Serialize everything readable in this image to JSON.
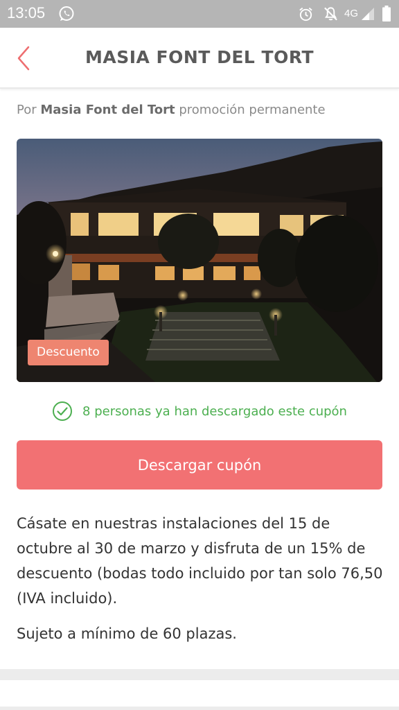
{
  "status_bar": {
    "time": "13:05",
    "network": "4G",
    "icons": [
      "whatsapp-icon",
      "alarm-icon",
      "notifications-off-icon",
      "signal-icon",
      "battery-icon"
    ]
  },
  "header": {
    "back_icon": "chevron-left-icon",
    "title": "MASIA FONT DEL TORT"
  },
  "byline": {
    "prefix": "Por",
    "vendor": "Masia Font del Tort",
    "suffix": "promoción permanente"
  },
  "hero": {
    "badge": "Descuento"
  },
  "downloads": {
    "icon": "check-circle-icon",
    "text": "8 personas ya han descargado este cupón"
  },
  "cta": {
    "label": "Descargar cupón"
  },
  "description": "Cásate en nuestras instalaciones del 15 de octubre al 30 de marzo y disfruta de un 15% de descuento (bodas todo incluido por tan solo 76,50 (IVA incluido).",
  "note": "Sujeto a mínimo de 60 plazas.",
  "colors": {
    "accent": "#f27173",
    "badge": "#ee8570",
    "success": "#4caf50",
    "status_bar": "#b5b5b5"
  }
}
